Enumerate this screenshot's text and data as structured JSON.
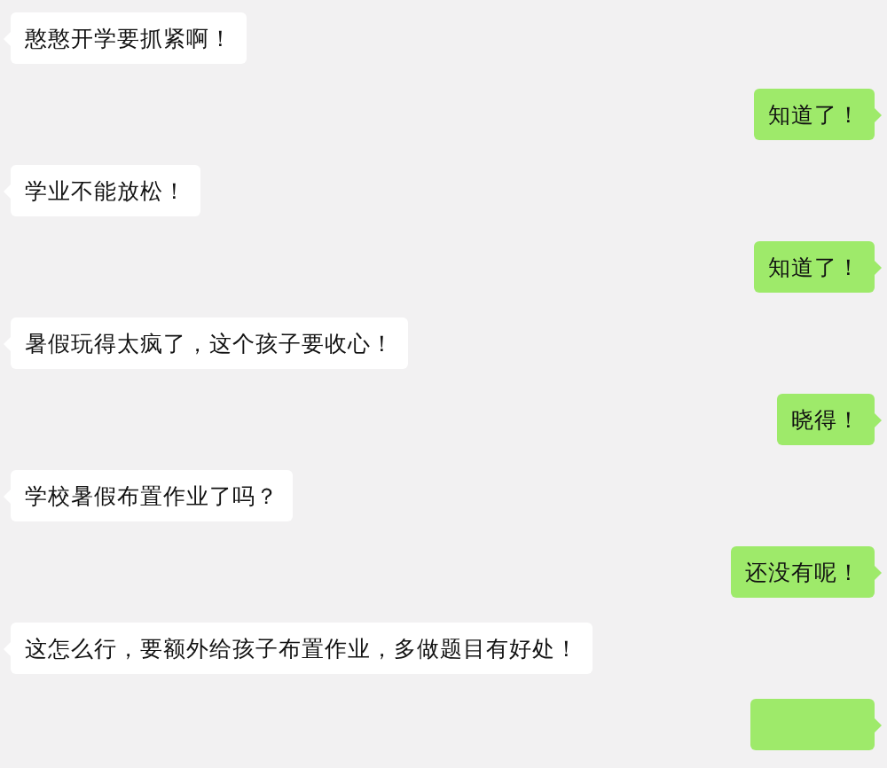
{
  "messages": [
    {
      "kind": "received",
      "text": "憨憨开学要抓紧啊！"
    },
    {
      "kind": "sent",
      "text": "知道了！"
    },
    {
      "kind": "received",
      "text": "学业不能放松！"
    },
    {
      "kind": "sent",
      "text": "知道了！"
    },
    {
      "kind": "received",
      "text": "暑假玩得太疯了，这个孩子要收心！"
    },
    {
      "kind": "sent",
      "text": "晓得！"
    },
    {
      "kind": "received",
      "text": "学校暑假布置作业了吗？"
    },
    {
      "kind": "sent",
      "text": "还没有呢！"
    },
    {
      "kind": "received",
      "text": "这怎么行，要额外给孩子布置作业，多做题目有好处！"
    },
    {
      "kind": "sent"
    }
  ]
}
